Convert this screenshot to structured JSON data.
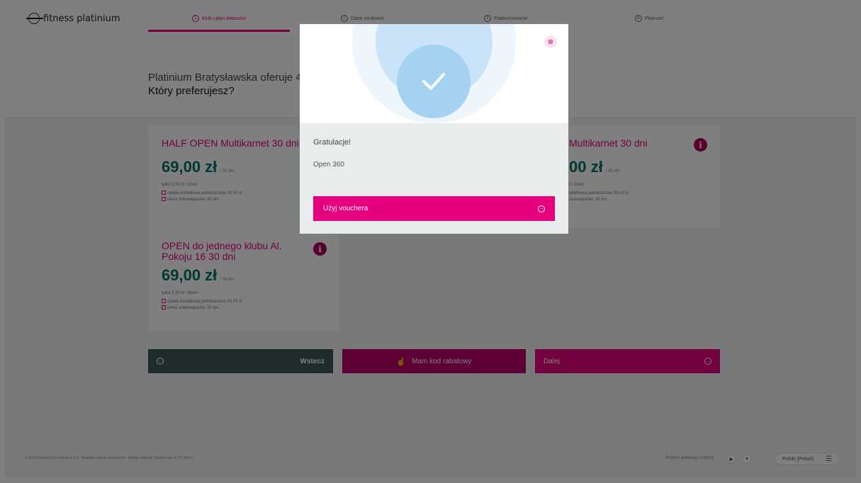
{
  "header": {
    "logo_text": "fitness platinium",
    "steps": [
      {
        "num": "1",
        "label": "Klub i plan płatności"
      },
      {
        "num": "2",
        "label": "Dane osobowe"
      },
      {
        "num": "3",
        "label": "Podsumowanie"
      },
      {
        "num": "4",
        "label": "Płatność"
      }
    ]
  },
  "heading": {
    "line1": "Platinium Bratysławska oferuje 4",
    "line2": "Który preferujesz?"
  },
  "cards": [
    {
      "title": "HALF OPEN Multikarnet 30 dni",
      "price": "69,00 zł",
      "period": "/ 30 dni",
      "daily": "tylko 2,30 zł / dzień",
      "fee": "opłata dodatkowa jednorazowa 30,00 zł",
      "commitment": "okres zobowiązania: 30 dni"
    },
    {
      "title": "Multikarnet 30 dni",
      "price": "00 zł",
      "period": "/ 30 dni",
      "daily": "ł / dzień",
      "fee": "odatkowa jednorazowa 30,00 zł",
      "commitment": "obowiązania: 30 dni"
    },
    {
      "title": "OPEN do jednego klubu Al. Pokoju 16 30 dni",
      "price": "69,00 zł",
      "period": "/ 30 dni",
      "daily": "tylko 2,30 zł / dzień",
      "fee": "opłata dodatkowa jednorazowa 30,00 zł",
      "commitment": "okres zobowiązania: 30 dni"
    }
  ],
  "info_icon_glyph": "i",
  "actions": {
    "back": "Wstecz",
    "code": "Mam kod rabatowy",
    "next": "Dalej"
  },
  "footer": {
    "copyright": "© 2019 Perfect Gym Solutions S.A. Wszelkie prawa zastrzeżone. Wersja aplikacji ClientPortal: 4.770.464.0",
    "mobile_label": "Pobierz aplikację mobilną",
    "language": "Polski (Polish)"
  },
  "modal": {
    "heading": "Gratulacje!",
    "subtext": "Open 360",
    "button": "Użyj vouchera"
  },
  "colors": {
    "brand_pink": "#e6007e",
    "price_teal": "#00706a",
    "back_button": "#3d5a59",
    "check_circle": "#a5d2f1"
  },
  "icons": [
    "check-icon",
    "close-icon",
    "info-icon",
    "arrow-left-icon",
    "arrow-right-icon",
    "hand-icon",
    "play-store-icon",
    "apple-icon",
    "menu-icon"
  ]
}
